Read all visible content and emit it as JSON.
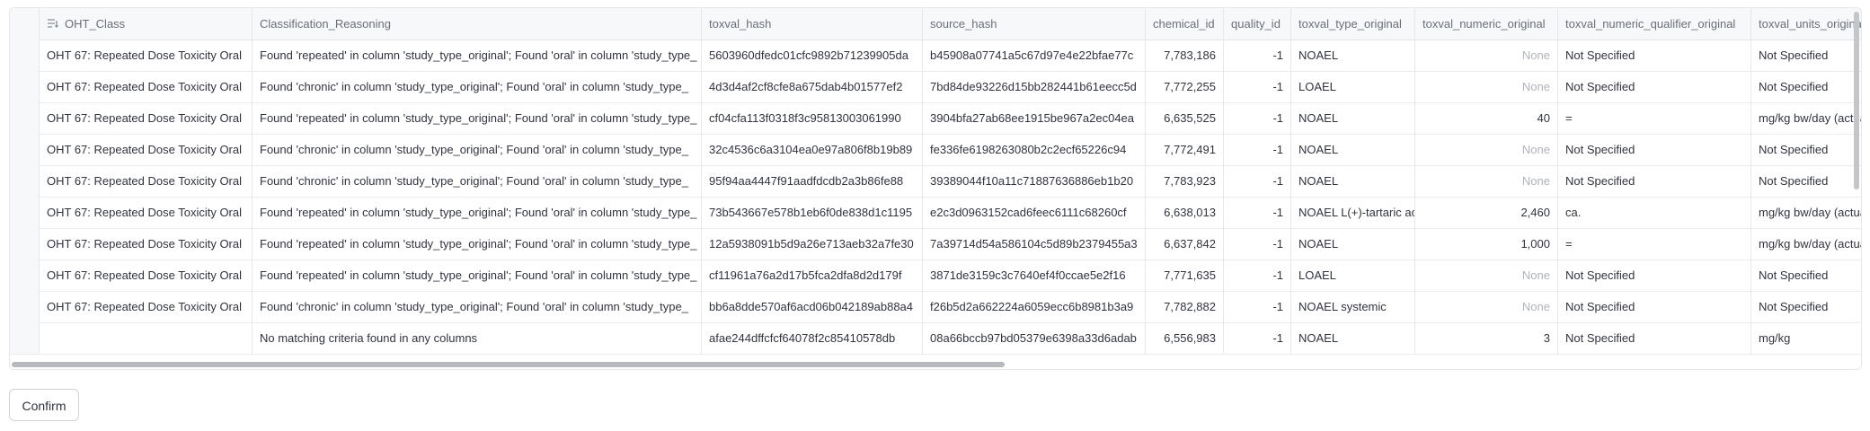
{
  "columns": [
    "OHT_Class",
    "Classification_Reasoning",
    "toxval_hash",
    "source_hash",
    "chemical_id",
    "quality_id",
    "toxval_type_original",
    "toxval_numeric_original",
    "toxval_numeric_qualifier_original",
    "toxval_units_original"
  ],
  "rows": [
    [
      "OHT 67: Repeated Dose Toxicity Oral",
      "Found 'repeated' in column 'study_type_original'; Found 'oral' in column 'study_type_",
      "5603960dfedc01cfc9892b71239905da",
      "b45908a07741a5c67d97e4e22bfae77c",
      "7,783,186",
      "-1",
      "NOAEL",
      "None",
      "Not Specified",
      "Not Specified"
    ],
    [
      "OHT 67: Repeated Dose Toxicity Oral",
      "Found 'chronic' in column 'study_type_original'; Found 'oral' in column 'study_type_",
      "4d3d4af2cf8cfe8a675dab4b01577ef2",
      "7bd84de93226d15bb282441b61eecc5d",
      "7,772,255",
      "-1",
      "LOAEL",
      "None",
      "Not Specified",
      "Not Specified"
    ],
    [
      "OHT 67: Repeated Dose Toxicity Oral",
      "Found 'repeated' in column 'study_type_original'; Found 'oral' in column 'study_type_",
      "cf04cfa113f0318f3c95813003061990",
      "3904bfa27ab68ee1915be967a2ec04ea",
      "6,635,525",
      "-1",
      "NOAEL",
      "40",
      "=",
      "mg/kg bw/day (actual"
    ],
    [
      "OHT 67: Repeated Dose Toxicity Oral",
      "Found 'chronic' in column 'study_type_original'; Found 'oral' in column 'study_type_",
      "32c4536c6a3104ea0e97a806f8b19b89",
      "fe336fe6198263080b2c2ecf65226c94",
      "7,772,491",
      "-1",
      "NOAEL",
      "None",
      "Not Specified",
      "Not Specified"
    ],
    [
      "OHT 67: Repeated Dose Toxicity Oral",
      "Found 'chronic' in column 'study_type_original'; Found 'oral' in column 'study_type_",
      "95f94aa4447f91aadfdcdb2a3b86fe88",
      "39389044f10a11c71887636886eb1b20",
      "7,783,923",
      "-1",
      "NOAEL",
      "None",
      "Not Specified",
      "Not Specified"
    ],
    [
      "OHT 67: Repeated Dose Toxicity Oral",
      "Found 'repeated' in column 'study_type_original'; Found 'oral' in column 'study_type_",
      "73b543667e578b1eb6f0de838d1c1195",
      "e2c3d0963152cad6feec6111c68260cf",
      "6,638,013",
      "-1",
      "NOAEL L(+)-tartaric ac",
      "2,460",
      "ca.",
      "mg/kg bw/day (actual"
    ],
    [
      "OHT 67: Repeated Dose Toxicity Oral",
      "Found 'repeated' in column 'study_type_original'; Found 'oral' in column 'study_type_",
      "12a5938091b5d9a26e713aeb32a7fe30",
      "7a39714d54a586104c5d89b2379455a3",
      "6,637,842",
      "-1",
      "NOAEL",
      "1,000",
      "=",
      "mg/kg bw/day (actual"
    ],
    [
      "OHT 67: Repeated Dose Toxicity Oral",
      "Found 'repeated' in column 'study_type_original'; Found 'oral' in column 'study_type_",
      "cf11961a76a2d17b5fca2dfa8d2d179f",
      "3871de3159c3c7640ef4f0ccae5e2f16",
      "7,771,635",
      "-1",
      "LOAEL",
      "None",
      "Not Specified",
      "Not Specified"
    ],
    [
      "OHT 67: Repeated Dose Toxicity Oral",
      "Found 'chronic' in column 'study_type_original'; Found 'oral' in column 'study_type_",
      "bb6a8dde570af6acd06b042189ab88a4",
      "f26b5d2a662224a6059ecc6b8981b3a9",
      "7,782,882",
      "-1",
      "NOAEL systemic",
      "None",
      "Not Specified",
      "Not Specified"
    ],
    [
      "",
      "No matching criteria found in any columns",
      "afae244dffcfcf64078f2c85410578db",
      "08a66bccb97bd05379e6398a33d6adab",
      "6,556,983",
      "-1",
      "NOAEL",
      "3",
      "Not Specified",
      "mg/kg"
    ]
  ],
  "confirm_button": "Confirm"
}
